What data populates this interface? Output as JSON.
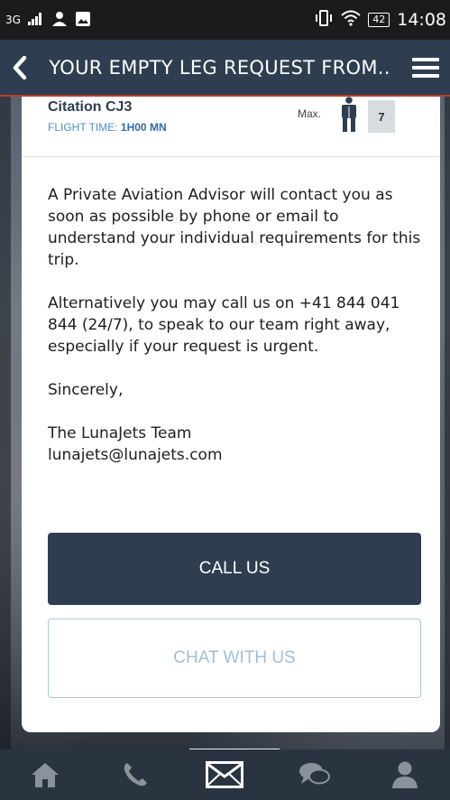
{
  "status_bar": {
    "network": "3G",
    "battery": "42",
    "time": "14:08"
  },
  "header": {
    "title": "YOUR EMPTY LEG REQUEST FROM.."
  },
  "aircraft": {
    "name": "Citation CJ3",
    "flight_time_label": "FLIGHT TIME:",
    "flight_time_value": "1H00 MN",
    "max_label": "Max.",
    "seats": "7"
  },
  "message": {
    "paragraph1": "A Private Aviation Advisor will contact you as soon as possible by phone or email to understand your individual requirements for this trip.",
    "paragraph2": "Alternatively you may call us on +41 844 041 844 (24/7), to speak to our team right away, especially if your request is urgent.",
    "closing": "Sincerely,",
    "signature_name": "The LunaJets Team",
    "signature_email": "lunajets@lunajets.com"
  },
  "buttons": {
    "call": "CALL US",
    "chat": "CHAT WITH US"
  },
  "colors": {
    "header_bg": "#2e3e50",
    "accent_red": "#c0392b",
    "link_blue": "#4a90c8"
  },
  "nav": {
    "items": [
      "home-icon",
      "phone-icon",
      "mail-icon",
      "chat-icon",
      "profile-icon"
    ],
    "active": "mail-icon"
  }
}
